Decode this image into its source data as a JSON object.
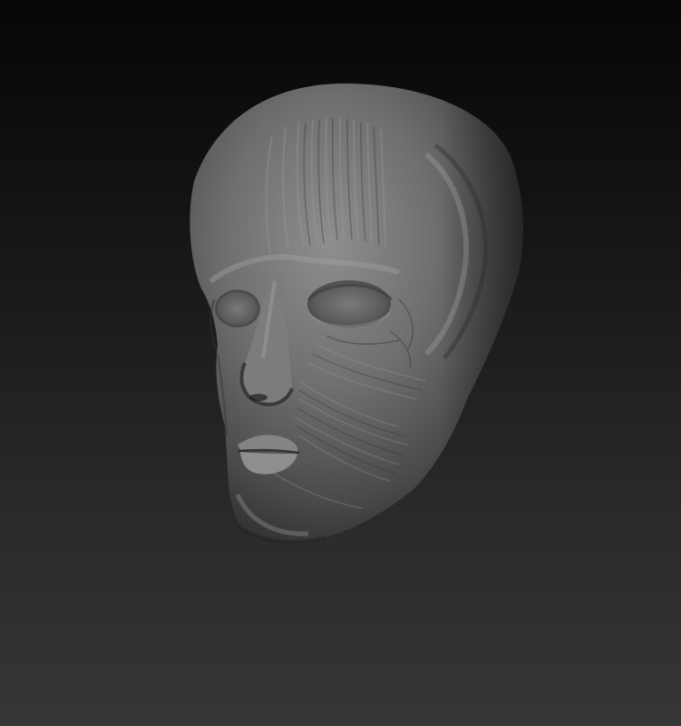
{
  "scene": {
    "subject": "sculpted-head",
    "colors": {
      "background_top": "#060606",
      "background_bottom": "#363636",
      "clay_base": "#6c6c6c",
      "clay_highlight": "#9a9a9a",
      "clay_shadow": "#2e2e2e"
    }
  }
}
